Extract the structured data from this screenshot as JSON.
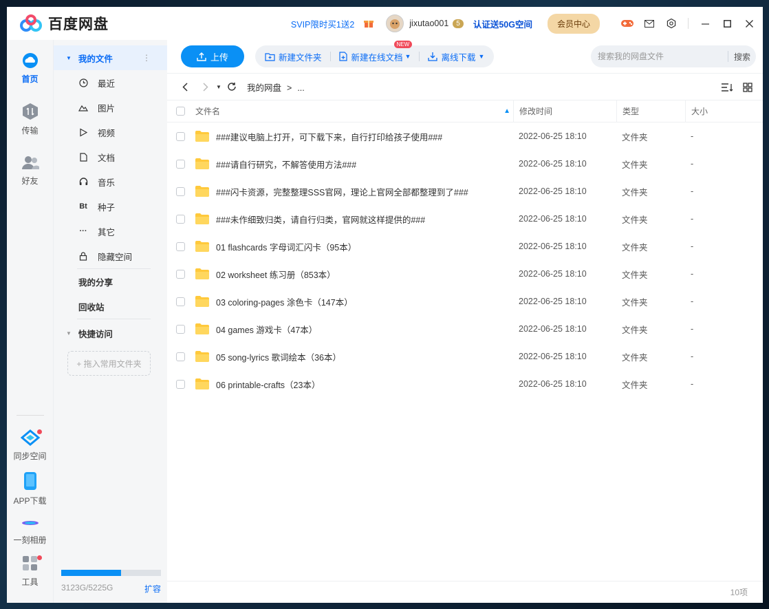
{
  "app": {
    "title": "百度网盘",
    "svip_promo": "SVIP限时买1送2",
    "username": "jixutao001",
    "vip_level": "5",
    "verify_promo": "认证送50G空间",
    "vip_center": "会员中心"
  },
  "rail": {
    "home": "首页",
    "transfer": "传输",
    "friends": "好友",
    "sync": "同步空间",
    "app_download": "APP下载",
    "album": "一刻相册",
    "tools": "工具"
  },
  "sidebar": {
    "my_files": "我的文件",
    "items": [
      {
        "label": "最近",
        "icon": "clock-icon"
      },
      {
        "label": "图片",
        "icon": "image-icon"
      },
      {
        "label": "视频",
        "icon": "play-icon"
      },
      {
        "label": "文档",
        "icon": "document-icon"
      },
      {
        "label": "音乐",
        "icon": "headphones-icon"
      },
      {
        "label": "种子",
        "icon": "bt-icon",
        "glyph": "Bt"
      },
      {
        "label": "其它",
        "icon": "more-icon",
        "glyph": "···"
      },
      {
        "label": "隐藏空间",
        "icon": "lock-icon"
      }
    ],
    "my_share": "我的分享",
    "recycle": "回收站",
    "quick_access": "快捷访问",
    "drop_hint": "+ 拖入常用文件夹",
    "quota_text": "3123G/5225G",
    "quota_used_fraction": 0.598,
    "expand": "扩容"
  },
  "toolbar": {
    "upload": "上传",
    "new_folder": "新建文件夹",
    "new_doc": "新建在线文档",
    "new_badge": "NEW",
    "offline_download": "离线下载",
    "search_placeholder": "搜索我的网盘文件",
    "search_button": "搜索"
  },
  "nav": {
    "breadcrumb_root": "我的网盘",
    "breadcrumb_sep": ">",
    "breadcrumb_more": "..."
  },
  "table": {
    "headers": {
      "name": "文件名",
      "time": "修改时间",
      "type": "类型",
      "size": "大小"
    },
    "rows": [
      {
        "name": "###建议电脑上打开，可下载下来，自行打印给孩子使用###",
        "time": "2022-06-25 18:10",
        "type": "文件夹",
        "size": "-"
      },
      {
        "name": "###请自行研究，不解答使用方法###",
        "time": "2022-06-25 18:10",
        "type": "文件夹",
        "size": "-"
      },
      {
        "name": "###闪卡资源，完整整理SSS官网，理论上官网全部都整理到了###",
        "time": "2022-06-25 18:10",
        "type": "文件夹",
        "size": "-"
      },
      {
        "name": "###未作细致归类，请自行归类，官网就这样提供的###",
        "time": "2022-06-25 18:10",
        "type": "文件夹",
        "size": "-"
      },
      {
        "name": "01 flashcards 字母词汇闪卡（95本）",
        "time": "2022-06-25 18:10",
        "type": "文件夹",
        "size": "-"
      },
      {
        "name": "02 worksheet 练习册（853本）",
        "time": "2022-06-25 18:10",
        "type": "文件夹",
        "size": "-"
      },
      {
        "name": "03 coloring-pages 涂色卡（147本）",
        "time": "2022-06-25 18:10",
        "type": "文件夹",
        "size": "-"
      },
      {
        "name": "04 games 游戏卡（47本）",
        "time": "2022-06-25 18:10",
        "type": "文件夹",
        "size": "-"
      },
      {
        "name": "05 song-lyrics 歌词绘本（36本）",
        "time": "2022-06-25 18:10",
        "type": "文件夹",
        "size": "-"
      },
      {
        "name": "06 printable-crafts（23本）",
        "time": "2022-06-25 18:10",
        "type": "文件夹",
        "size": "-"
      }
    ],
    "item_count": "10项"
  },
  "colors": {
    "accent": "#0a90f5",
    "link": "#0a6cf5",
    "folder": "#ffc93c"
  }
}
